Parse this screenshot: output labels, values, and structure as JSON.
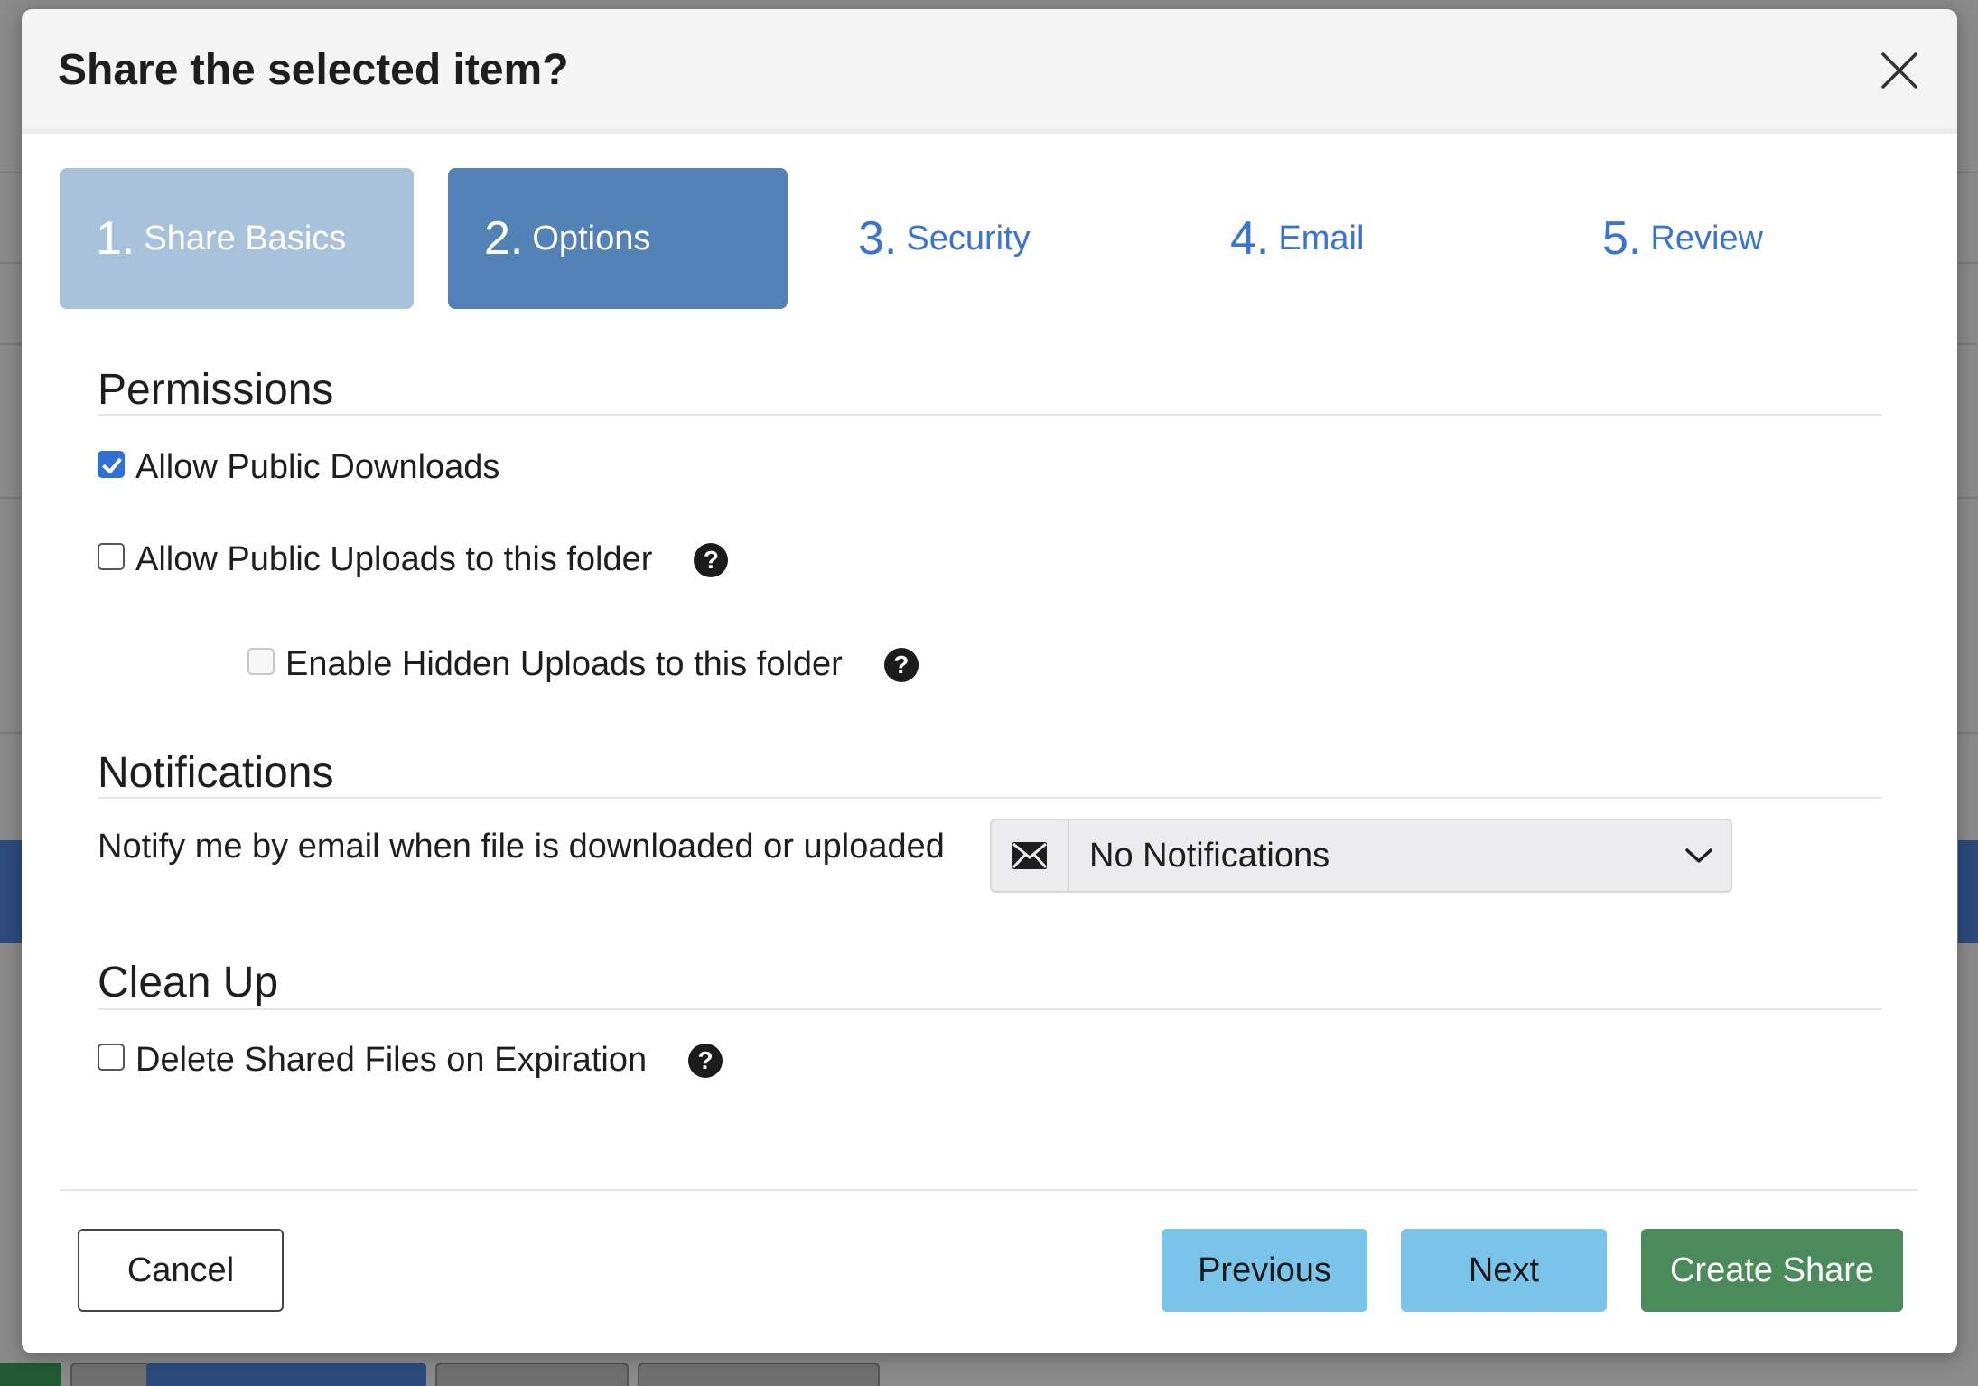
{
  "dialog": {
    "title": "Share the selected item?"
  },
  "steps": [
    {
      "number": "1.",
      "label": "Share Basics",
      "state": "completed"
    },
    {
      "number": "2.",
      "label": "Options",
      "state": "active"
    },
    {
      "number": "3.",
      "label": "Security",
      "state": "upcoming"
    },
    {
      "number": "4.",
      "label": "Email",
      "state": "upcoming"
    },
    {
      "number": "5.",
      "label": "Review",
      "state": "upcoming"
    }
  ],
  "permissions": {
    "title": "Permissions",
    "allow_downloads": {
      "label": "Allow Public Downloads",
      "checked": true
    },
    "allow_uploads": {
      "label": "Allow Public Uploads to this folder",
      "checked": false
    },
    "hidden_uploads": {
      "label": "Enable Hidden Uploads to this folder",
      "checked": false,
      "disabled": true
    }
  },
  "notifications": {
    "title": "Notifications",
    "label": "Notify me by email when file is downloaded or uploaded",
    "selected": "No Notifications",
    "icon": "envelope-icon"
  },
  "cleanup": {
    "title": "Clean Up",
    "delete_on_expiration": {
      "label": "Delete Shared Files on Expiration",
      "checked": false
    }
  },
  "footer": {
    "cancel_label": "Cancel",
    "previous_label": "Previous",
    "next_label": "Next",
    "create_label": "Create Share"
  },
  "help_icon_glyph": "?",
  "colors": {
    "step_completed": "#a9c2dc",
    "step_active": "#5382b6",
    "step_link": "#3a74d0",
    "button_info": "#79c4e8",
    "button_success": "#4a8a5b",
    "checkbox_checked": "#2f6fd6"
  }
}
